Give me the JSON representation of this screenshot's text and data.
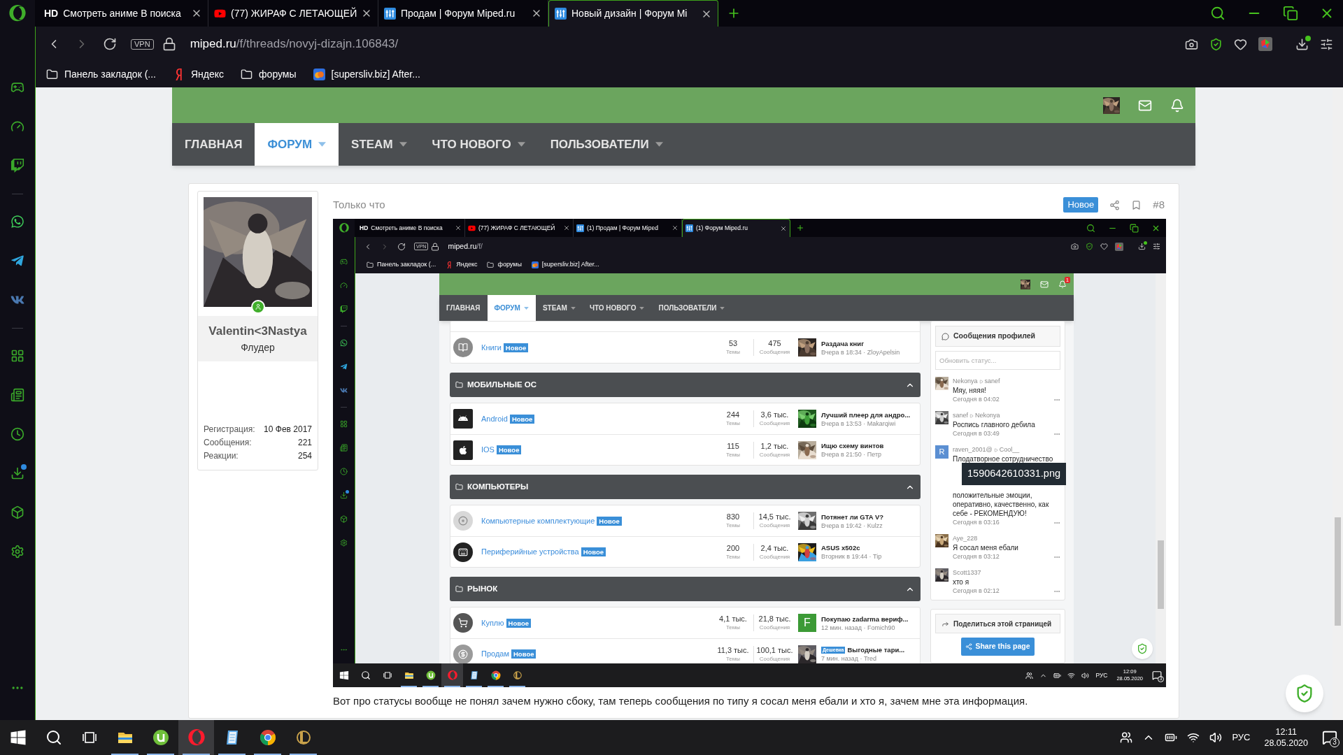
{
  "browser": {
    "tabs": [
      {
        "kind": "hd",
        "badge": "HD",
        "title": "Смотреть аниме В поиска",
        "selected": false
      },
      {
        "kind": "youtube",
        "title": "(77) ЖИРАФ С ЛЕТАЮЩЕЙ",
        "selected": false
      },
      {
        "kind": "forum",
        "title": "Продам | Форум Miped.ru",
        "selected": false
      },
      {
        "kind": "forum",
        "title": "Новый дизайн | Форум Mi",
        "selected": true
      }
    ],
    "vpn": "VPN",
    "url_host": "miped.ru",
    "url_path": "/f/threads/novyj-dizajn.106843/",
    "bookmarks": [
      {
        "kind": "folder",
        "label": "Панель закладок (..."
      },
      {
        "kind": "yandex",
        "label": "Яндекс"
      },
      {
        "kind": "folder",
        "label": "форумы"
      },
      {
        "kind": "site",
        "label": "[supersliv.biz] After..."
      }
    ]
  },
  "forum": {
    "nav": [
      {
        "label": "ГЛАВНАЯ",
        "selected": false,
        "dropdown": false
      },
      {
        "label": "ФОРУМ",
        "selected": true,
        "dropdown": true
      },
      {
        "label": "STEAM",
        "selected": false,
        "dropdown": true
      },
      {
        "label": "ЧТО НОВОГО",
        "selected": false,
        "dropdown": true
      },
      {
        "label": "ПОЛЬЗОВАТЕЛИ",
        "selected": false,
        "dropdown": true
      }
    ]
  },
  "post": {
    "time": "Только что",
    "badge": "Новое",
    "number": "#8",
    "author": {
      "name": "Valentin<3Nastya",
      "title": "Флудер",
      "online": true,
      "stats": [
        {
          "label": "Регистрация:",
          "value": "10 Фев 2017"
        },
        {
          "label": "Сообщения:",
          "value": "221"
        },
        {
          "label": "Реакции:",
          "value": "254"
        }
      ]
    },
    "screenshot": {
      "tabs": [
        {
          "kind": "hd",
          "badge": "HD",
          "title": "Смотреть аниме В поиска",
          "selected": false
        },
        {
          "kind": "youtube",
          "title": "(77) ЖИРАФ С ЛЕТАЮЩЕЙ",
          "selected": false
        },
        {
          "kind": "forum",
          "title": "(1) Продам | Форум Miped",
          "selected": false
        },
        {
          "kind": "forum",
          "title": "(1) Форум Miped.ru",
          "selected": true
        }
      ],
      "vpn": "VPN",
      "url_host": "miped.ru",
      "url_path": "/f/",
      "bookmarks": [
        {
          "kind": "folder",
          "label": "Панель закладок (..."
        },
        {
          "kind": "yandex",
          "label": "Яндекс"
        },
        {
          "kind": "folder",
          "label": "форумы"
        },
        {
          "kind": "site",
          "label": "[supersliv.biz] After..."
        }
      ],
      "forum": {
        "notifications": "1",
        "nav": [
          {
            "label": "ГЛАВНАЯ",
            "selected": false,
            "dropdown": false
          },
          {
            "label": "ФОРУМ",
            "selected": true,
            "dropdown": true
          },
          {
            "label": "STEAM",
            "selected": false,
            "dropdown": true
          },
          {
            "label": "ЧТО НОВОГО",
            "selected": false,
            "dropdown": true
          },
          {
            "label": "ПОЛЬЗОВАТЕЛИ",
            "selected": false,
            "dropdown": true
          }
        ],
        "sections": [
          {
            "forums": [
              {
                "kind": "book",
                "name": "Книги",
                "badge": "Новое",
                "threads": "53",
                "threads_label": "Темы",
                "messages": "475",
                "messages_label": "Сообщения",
                "last_title": "Раздача книг",
                "last_meta": "Вчера в 18:34 · ZloyApelsin",
                "last_avatar": {
                  "kind": "picture"
                }
              }
            ]
          },
          {
            "title": "МОБИЛЬНЫЕ ОС",
            "expanded": true,
            "forums": [
              {
                "kind": "android",
                "name": "Android",
                "badge": "Новое",
                "threads": "244",
                "threads_label": "Темы",
                "messages": "3,6 тыс.",
                "messages_label": "Сообщения",
                "last_title": "Лучший плеер для андро...",
                "last_meta": "Вчера в 13:53 · Makarqiwi",
                "last_avatar": {
                  "kind": "picture"
                }
              },
              {
                "kind": "apple",
                "name": "IOS",
                "badge": "Новое",
                "threads": "115",
                "threads_label": "Темы",
                "messages": "1,2 тыс.",
                "messages_label": "Сообщения",
                "last_title": "Ищю схему винтов",
                "last_meta": "Вчера в 21:50 · Петр",
                "last_avatar": {
                  "kind": "picture"
                }
              }
            ]
          },
          {
            "title": "КОМПЬЮТЕРЫ",
            "expanded": true,
            "forums": [
              {
                "kind": "disc",
                "name": "Компьютерные комплектующие",
                "badge": "Новое",
                "threads": "830",
                "threads_label": "Темы",
                "messages": "14,5 тыс.",
                "messages_label": "Сообщения",
                "last_title": "Потянет ли GTA V?",
                "last_meta": "Вчера в 19:42 · Kulzz",
                "last_avatar": {
                  "kind": "picture"
                }
              },
              {
                "kind": "keyboard",
                "name": "Периферийные устройства",
                "badge": "Новое",
                "threads": "200",
                "threads_label": "Темы",
                "messages": "2,4 тыс.",
                "messages_label": "Сообщения",
                "last_title": "ASUS x502c",
                "last_meta": "Вторник в 19:44 · Tip",
                "last_avatar": {
                  "kind": "picture"
                }
              }
            ]
          },
          {
            "title": "РЫНОК",
            "expanded": true,
            "forums": [
              {
                "kind": "cart",
                "name": "Куплю",
                "badge": "Новое",
                "threads": "4,1 тыс.",
                "threads_label": "Темы",
                "messages": "21,8 тыс.",
                "messages_label": "Сообщения",
                "last_title": "Покупаю zadarma вериф...",
                "last_meta": "12 мин. назад · Fomich90",
                "last_avatar": {
                  "kind": "letter",
                  "letter": "F",
                  "color": "#3c9a36"
                }
              },
              {
                "kind": "money",
                "name": "Продам",
                "badge": "Новое",
                "threads": "11,3 тыс.",
                "threads_label": "Темы",
                "messages": "100,1 тыс.",
                "messages_label": "Сообщения",
                "last_prefix": "Дешевка",
                "last_title": "Выгодные тари...",
                "last_meta": "7 мин. назад · Tred",
                "last_avatar": {
                  "kind": "picture"
                }
              }
            ]
          }
        ]
      },
      "profile_posts": {
        "title": "Сообщения профилей",
        "placeholder": "Обновить статус...",
        "items": [
          {
            "from": "Nekonya",
            "to": "sanef",
            "lines": [
              "Мяу, няяя!"
            ],
            "time": "Сегодня в 04:02",
            "avatar": {
              "kind": "picture"
            }
          },
          {
            "from": "sanef",
            "to": "Nekonya",
            "lines": [
              "Роспись главного дебила"
            ],
            "time": "Сегодня в 03:49",
            "avatar": {
              "kind": "picture"
            }
          },
          {
            "from": "raven_2001@",
            "to": "Cool__",
            "lines": [
              "Плодатворное сотрудничество",
              "положительные эмоции,",
              "оперативно, качественно, как",
              "себе - РЕКОМЕНДУЮ!"
            ],
            "tooltip": "1590642610331.png",
            "time": "Сегодня в 03:16",
            "avatar": {
              "kind": "letter",
              "letter": "R",
              "color": "#5b8fd2"
            }
          },
          {
            "from": "Aye_228",
            "lines": [
              "Я сосал меня ебали"
            ],
            "time": "Сегодня в 03:12",
            "avatar": {
              "kind": "picture"
            }
          },
          {
            "from": "Scott1337",
            "lines": [
              "хто я"
            ],
            "time": "Сегодня в 02:12",
            "avatar": {
              "kind": "picture"
            }
          }
        ]
      },
      "share": {
        "title": "Поделиться этой страницей",
        "button": "Share this page"
      },
      "taskbar": {
        "apps": [
          {
            "kind": "explorer",
            "running": true,
            "selected": false
          },
          {
            "kind": "utorrent",
            "running": true,
            "selected": false
          },
          {
            "kind": "opera",
            "running": true,
            "selected": true
          },
          {
            "kind": "notes",
            "running": true,
            "selected": false
          },
          {
            "kind": "chrome",
            "running": true,
            "selected": false
          },
          {
            "kind": "lol",
            "running": true,
            "selected": false
          }
        ],
        "language": "РУС",
        "time": "12:09",
        "date": "28.05.2020",
        "notifications": "3"
      }
    },
    "text": "Вот про статусы вообще не понял зачем нужно сбоку, там теперь сообщения по типу я сосал меня ебали и хто я, зачем мне эта информация."
  },
  "taskbar": {
    "apps": [
      {
        "kind": "explorer",
        "running": true,
        "selected": false
      },
      {
        "kind": "utorrent",
        "running": true,
        "selected": false
      },
      {
        "kind": "opera",
        "running": true,
        "selected": true
      },
      {
        "kind": "notes",
        "running": true,
        "selected": false
      },
      {
        "kind": "chrome",
        "running": true,
        "selected": false
      },
      {
        "kind": "lol",
        "running": true,
        "selected": false
      }
    ],
    "language": "РУС",
    "time": "12:11",
    "date": "28.05.2020",
    "notifications": "3"
  }
}
